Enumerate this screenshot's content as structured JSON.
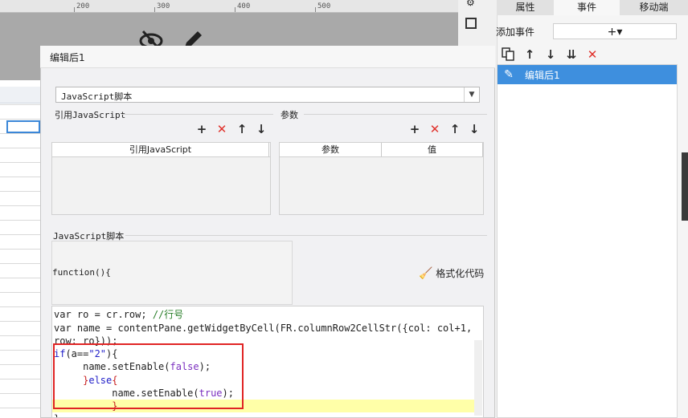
{
  "ruler": {
    "ticks": [
      "200",
      "300",
      "400",
      "500"
    ]
  },
  "canvas": {
    "icons": [
      "eye-off-icon",
      "pencil-icon"
    ]
  },
  "right_panel": {
    "tabs": [
      "属性",
      "事件",
      "移动端"
    ],
    "add_event_label": "添加事件",
    "add_event_button": "+▾",
    "toolbar_icons": [
      "copy-icon",
      "arrow-up-icon",
      "arrow-down-icon",
      "move-bottom-icon",
      "delete-icon"
    ],
    "events": [
      {
        "label": "编辑后1",
        "selected": true
      }
    ]
  },
  "dialog": {
    "title": "编辑后1",
    "type_select": {
      "value": "JavaScript脚本"
    },
    "ref_section": {
      "title": "引用JavaScript",
      "column": "引用JavaScript"
    },
    "param_section": {
      "title": "参数",
      "columns": [
        "参数",
        "值"
      ]
    },
    "script_section": {
      "title": "JavaScript脚本",
      "function_header": "function(){",
      "format_button": "格式化代码"
    },
    "code": {
      "line1": {
        "a": "var ro = cr.row; ",
        "b": "//行号"
      },
      "line2": {
        "a": "var name = contentPane.getWidgetByCell(FR.columnRow2CellStr({col: col+1,",
        "b": "row: ro}));"
      },
      "line3": {
        "kw": "if",
        "a": "(a==",
        "s": "\"2\"",
        "b": "){"
      },
      "line4": {
        "a": "     name.setEnable(",
        "v": "false",
        "b": ");"
      },
      "line5": {
        "a": "     ",
        "brace1": "}",
        "kw": "else",
        "brace2": "{"
      },
      "line6": {
        "a": "          name.setEnable(",
        "v": "true",
        "b": ");"
      },
      "line7": {
        "a": "          ",
        "brace": "}"
      },
      "line8": {
        "brace": "}"
      }
    }
  },
  "colors": {
    "accent": "#3e8fde",
    "delete": "#e0312b",
    "highlight_box": "#e02424",
    "current_line": "#ffffa8"
  }
}
